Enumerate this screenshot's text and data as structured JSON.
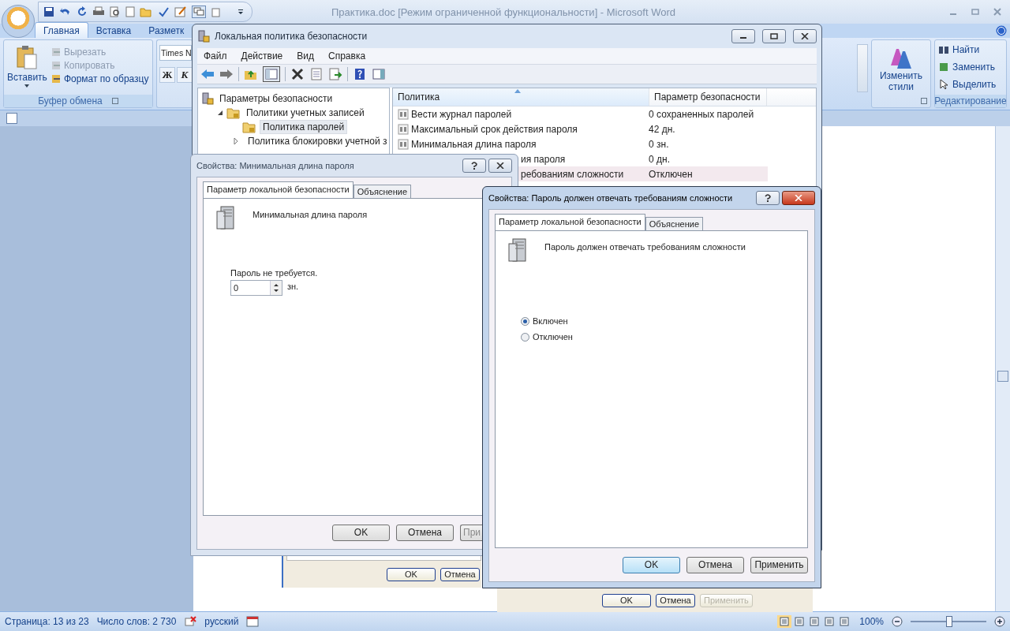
{
  "word": {
    "title": "Практика.doc [Режим ограниченной функциональности] - Microsoft Word",
    "tabs": [
      {
        "label": "Главная",
        "selected": true
      },
      {
        "label": "Вставка",
        "selected": false
      },
      {
        "label": "Разметк",
        "selected": false
      }
    ],
    "clipboard": {
      "paste": "Вставить",
      "items": [
        {
          "label": "Вырезать",
          "disabled": true
        },
        {
          "label": "Копировать",
          "disabled": true
        },
        {
          "label": "Формат по образцу",
          "disabled": false
        }
      ],
      "group": "Буфер обмена"
    },
    "font": {
      "name": "Times N",
      "bold": "Ж",
      "italic": "К"
    },
    "styles": {
      "label": "Изменить стили"
    },
    "editing": {
      "items": [
        "Найти",
        "Заменить",
        "Выделить"
      ],
      "group": "Редактирование"
    },
    "status": {
      "page": "Страница: 13 из 23",
      "words": "Число слов: 2 730",
      "language": "русский",
      "zoom": "100%",
      "zoom_slider": {
        "level": 0.5
      }
    }
  },
  "document": {
    "panels": [
      {
        "buttons": [
          {
            "label": "OK",
            "disabled": false
          },
          {
            "label": "Отмена",
            "disabled": false
          }
        ]
      },
      {
        "buttons": [
          {
            "label": "OK",
            "disabled": false
          },
          {
            "label": "Отмена",
            "disabled": false
          },
          {
            "label": "Применить",
            "disabled": true
          }
        ]
      }
    ]
  },
  "policy_window": {
    "title": "Локальная политика безопасности",
    "menu": [
      "Файл",
      "Действие",
      "Вид",
      "Справка"
    ],
    "tree": [
      {
        "label": "Параметры безопасности",
        "selected": false,
        "children": [
          {
            "label": "Политики учетных записей",
            "selected": false,
            "expanded": true,
            "children": [
              {
                "label": "Политика паролей",
                "selected": true
              },
              {
                "label": "Политика блокировки учетной з",
                "selected": false,
                "expanded": false
              }
            ]
          }
        ]
      }
    ],
    "columns": [
      "Политика",
      "Параметр безопасности"
    ],
    "rows": [
      {
        "kind": "full",
        "policy": "Вести журнал паролей",
        "value": "0 сохраненных паролей",
        "selected": false
      },
      {
        "kind": "full",
        "policy": "Максимальный срок действия пароля",
        "value": "42 дн.",
        "selected": false
      },
      {
        "kind": "full",
        "policy": "Минимальная длина пароля",
        "value": "0 зн.",
        "selected": false
      },
      {
        "kind": "clipped",
        "policy": "ия пароля",
        "value": "0 дн.",
        "selected": false
      },
      {
        "kind": "clipped",
        "policy": "ребованиям сложности",
        "value": "Отключен",
        "selected": true
      }
    ]
  },
  "dialogs": [
    {
      "kind": "spin",
      "active": false,
      "title": "Свойства: Минимальная длина пароля",
      "tabs": [
        {
          "label": "Параметр локальной безопасности",
          "selected": true
        },
        {
          "label": "Объяснение",
          "selected": false
        }
      ],
      "heading": "Минимальная длина пароля",
      "note": "Пароль не требуется.",
      "value": "0",
      "unit": "зн.",
      "buttons": [
        {
          "label": "OK",
          "default": false
        },
        {
          "label": "Отмена",
          "default": false
        },
        {
          "label": "При",
          "default": false
        }
      ]
    },
    {
      "kind": "radio",
      "active": true,
      "title": "Свойства: Пароль должен отвечать требованиям сложности",
      "tabs": [
        {
          "label": "Параметр локальной безопасности",
          "selected": true
        },
        {
          "label": "Объяснение",
          "selected": false
        }
      ],
      "heading": "Пароль должен отвечать требованиям сложности",
      "options": [
        {
          "label": "Включен",
          "selected": true
        },
        {
          "label": "Отключен",
          "selected": false
        }
      ],
      "buttons": [
        {
          "label": "OK",
          "default": true
        },
        {
          "label": "Отмена",
          "default": false
        },
        {
          "label": "Применить",
          "default": false
        }
      ]
    }
  ]
}
